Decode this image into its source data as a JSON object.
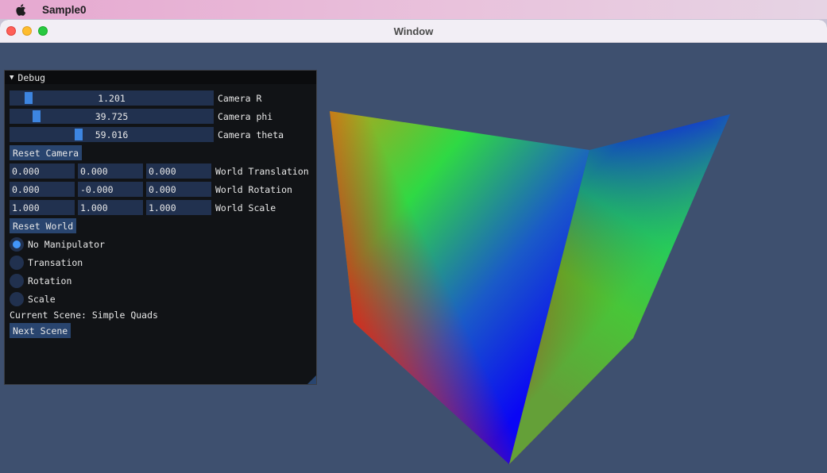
{
  "menubar": {
    "app_name": "Sample0",
    "apple_icon": "apple-logo-icon"
  },
  "window": {
    "title": "Window"
  },
  "panel": {
    "title": "Debug",
    "sliders": [
      {
        "value": "1.201",
        "label": "Camera R",
        "fraction": 0.07
      },
      {
        "value": "39.725",
        "label": "Camera phi",
        "fraction": 0.11
      },
      {
        "value": "59.016",
        "label": "Camera theta",
        "fraction": 0.33
      }
    ],
    "reset_camera_label": "Reset Camera",
    "vector_rows": [
      {
        "values": [
          "0.000",
          "0.000",
          "0.000"
        ],
        "label": "World Translation"
      },
      {
        "values": [
          "0.000",
          "-0.000",
          "0.000"
        ],
        "label": "World Rotation"
      },
      {
        "values": [
          "1.000",
          "1.000",
          "1.000"
        ],
        "label": "World Scale"
      }
    ],
    "reset_world_label": "Reset World",
    "radios": [
      {
        "label": "No Manipulator",
        "selected": true
      },
      {
        "label": "Transation",
        "selected": false
      },
      {
        "label": "Rotation",
        "selected": false
      },
      {
        "label": "Scale",
        "selected": false
      }
    ],
    "current_scene_text": "Current Scene: Simple Quads",
    "next_scene_label": "Next Scene"
  },
  "colors": {
    "background": "#3e506f",
    "panel_bg": "#111316",
    "frame_bg": "#21314f",
    "button_bg": "#29456f",
    "slider_grab": "#3d85e0",
    "radio_check": "#4296fa"
  }
}
